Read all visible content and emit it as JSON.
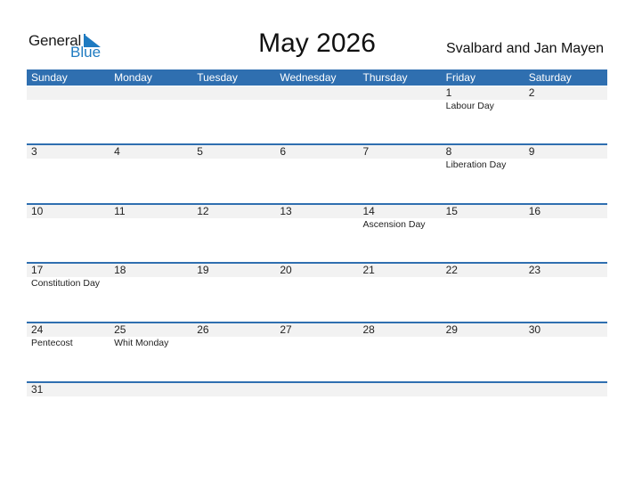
{
  "logo": {
    "general": "General",
    "blue": "Blue"
  },
  "title": "May 2026",
  "region": "Svalbard and Jan Mayen",
  "colors": {
    "accent": "#2f6fb0",
    "logo_blue": "#1f7bc1",
    "date_row_bg": "#f2f2f2"
  },
  "weekdays": [
    "Sunday",
    "Monday",
    "Tuesday",
    "Wednesday",
    "Thursday",
    "Friday",
    "Saturday"
  ],
  "weeks": [
    [
      {
        "day": "",
        "holiday": ""
      },
      {
        "day": "",
        "holiday": ""
      },
      {
        "day": "",
        "holiday": ""
      },
      {
        "day": "",
        "holiday": ""
      },
      {
        "day": "",
        "holiday": ""
      },
      {
        "day": "1",
        "holiday": "Labour Day"
      },
      {
        "day": "2",
        "holiday": ""
      }
    ],
    [
      {
        "day": "3",
        "holiday": ""
      },
      {
        "day": "4",
        "holiday": ""
      },
      {
        "day": "5",
        "holiday": ""
      },
      {
        "day": "6",
        "holiday": ""
      },
      {
        "day": "7",
        "holiday": ""
      },
      {
        "day": "8",
        "holiday": "Liberation Day"
      },
      {
        "day": "9",
        "holiday": ""
      }
    ],
    [
      {
        "day": "10",
        "holiday": ""
      },
      {
        "day": "11",
        "holiday": ""
      },
      {
        "day": "12",
        "holiday": ""
      },
      {
        "day": "13",
        "holiday": ""
      },
      {
        "day": "14",
        "holiday": "Ascension Day"
      },
      {
        "day": "15",
        "holiday": ""
      },
      {
        "day": "16",
        "holiday": ""
      }
    ],
    [
      {
        "day": "17",
        "holiday": "Constitution Day"
      },
      {
        "day": "18",
        "holiday": ""
      },
      {
        "day": "19",
        "holiday": ""
      },
      {
        "day": "20",
        "holiday": ""
      },
      {
        "day": "21",
        "holiday": ""
      },
      {
        "day": "22",
        "holiday": ""
      },
      {
        "day": "23",
        "holiday": ""
      }
    ],
    [
      {
        "day": "24",
        "holiday": "Pentecost"
      },
      {
        "day": "25",
        "holiday": "Whit Monday"
      },
      {
        "day": "26",
        "holiday": ""
      },
      {
        "day": "27",
        "holiday": ""
      },
      {
        "day": "28",
        "holiday": ""
      },
      {
        "day": "29",
        "holiday": ""
      },
      {
        "day": "30",
        "holiday": ""
      }
    ],
    [
      {
        "day": "31",
        "holiday": ""
      },
      {
        "day": "",
        "holiday": ""
      },
      {
        "day": "",
        "holiday": ""
      },
      {
        "day": "",
        "holiday": ""
      },
      {
        "day": "",
        "holiday": ""
      },
      {
        "day": "",
        "holiday": ""
      },
      {
        "day": "",
        "holiday": ""
      }
    ]
  ]
}
